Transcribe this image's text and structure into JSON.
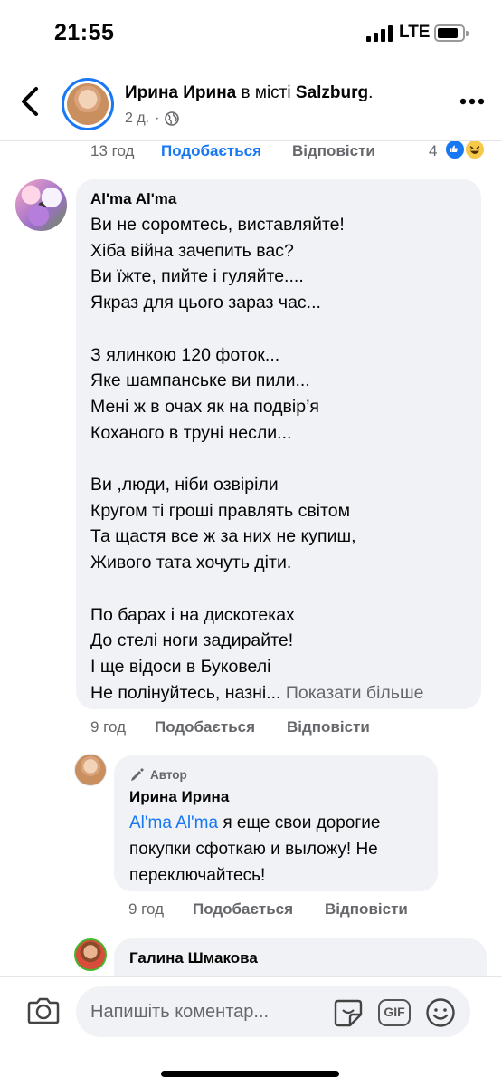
{
  "status": {
    "time": "21:55",
    "network": "LTE"
  },
  "header": {
    "author": "Ирина Ирина",
    "location_prefix": " в місті ",
    "location": "Salzburg",
    "location_suffix": ".",
    "age": "2 д.",
    "separator": "·"
  },
  "previous_comment_actions": {
    "time": "13 год",
    "like": "Подобається",
    "reply": "Відповісти",
    "reaction_count": "4"
  },
  "comments": [
    {
      "author": "Al'ma Al'ma",
      "text": "Ви не соромтесь, виставляйте!\nХіба війна зачепить вас?\nВи їжте, пийте і гуляйте....\nЯкраз для цього зараз час...\n\nЗ ялинкою 120 фоток...\nЯке шампанське ви пили...\nМені ж в очах як на подвір’я\nКоханого в труні несли...\n\nВи ,люди, ніби озвіріли\nКругом ті гроші правлять світом\nТа щастя все ж за них не купиш,\nЖивого тата хочуть діти.\n\nПо барах і на дискотеках\nДо стелі ноги задирайте!\nІ ще відоси в Буковелі\nНе полінуйтесь, назні...",
      "see_more": " Показати більше",
      "time": "9 год",
      "like": "Подобається",
      "reply": "Відповісти"
    },
    {
      "badge": "Автор",
      "author": "Ирина Ирина",
      "mention": "Al'ma Al'ma",
      "text": " я еще свои дорогие покупки сфоткаю и выложу! Не переключайтесь!",
      "time": "9 год",
      "like": "Подобається",
      "reply": "Відповісти"
    },
    {
      "author": "Галина Шмакова"
    }
  ],
  "composer": {
    "placeholder": "Напишіть коментар...",
    "gif_label": "GIF"
  },
  "icons": [
    "back-icon",
    "globe-icon",
    "more-icon",
    "like-reaction-icon",
    "haha-reaction-icon",
    "pencil-icon",
    "camera-icon",
    "sticker-icon",
    "gif-icon",
    "emoji-icon"
  ],
  "colors": {
    "accent": "#1877f2",
    "bubble": "#f0f2f5",
    "secondary_text": "#65676b"
  }
}
